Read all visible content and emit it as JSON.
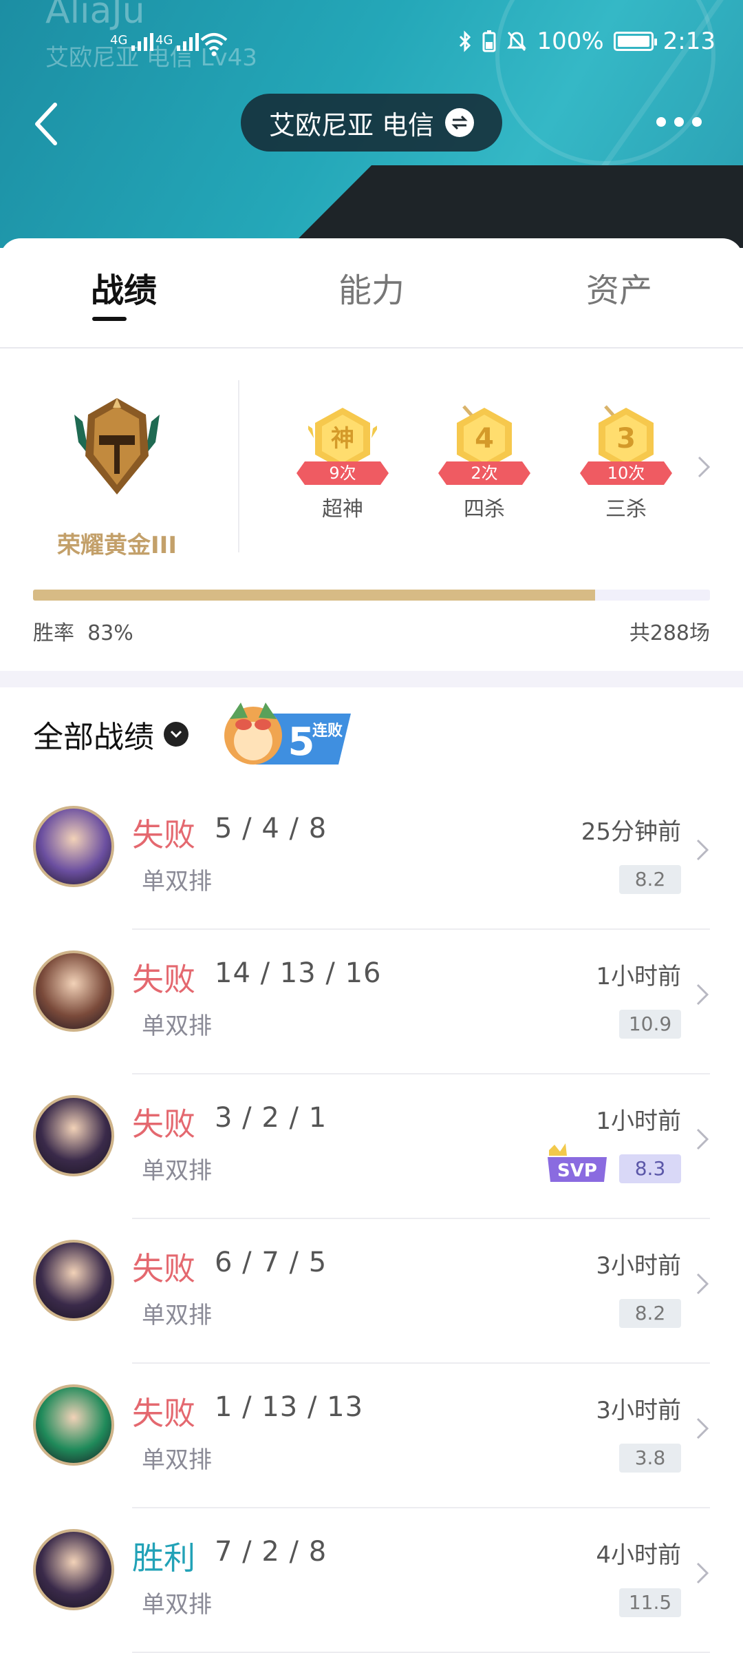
{
  "ghost_header": {
    "name": "AliaJu",
    "sub": "艾欧尼亚 电信 Lv43"
  },
  "status_bar": {
    "signal1_label": "4G",
    "signal2_label": "4G",
    "battery": "100%",
    "time": "2:13"
  },
  "nav": {
    "server": "艾欧尼亚 电信"
  },
  "tabs": [
    {
      "label": "战绩"
    },
    {
      "label": "能力"
    },
    {
      "label": "资产"
    }
  ],
  "rank": {
    "name": "荣耀黄金III"
  },
  "medals": [
    {
      "glyph": "神",
      "count": "9次",
      "label": "超神"
    },
    {
      "glyph": "4",
      "count": "2次",
      "label": "四杀"
    },
    {
      "glyph": "3",
      "count": "10次",
      "label": "三杀"
    }
  ],
  "summary": {
    "winrate_label": "胜率",
    "winrate_value": "83%",
    "winrate_fraction": 0.83,
    "total": "共288场"
  },
  "filter": {
    "label": "全部战绩",
    "streak_number": "5",
    "streak_text": "连败"
  },
  "matches": [
    {
      "result": "失败",
      "outcome": "lose",
      "kda": "5 / 4 / 8",
      "mode": "单双排",
      "time": "25分钟前",
      "score": "8.2",
      "svp": false,
      "avatar_color": "#6b4fa0"
    },
    {
      "result": "失败",
      "outcome": "lose",
      "kda": "14 / 13 / 16",
      "mode": "单双排",
      "time": "1小时前",
      "score": "10.9",
      "svp": false,
      "avatar_color": "#7a4a3a"
    },
    {
      "result": "失败",
      "outcome": "lose",
      "kda": "3 / 2 / 1",
      "mode": "单双排",
      "time": "1小时前",
      "score": "8.3",
      "svp": true,
      "svp_label": "SVP",
      "avatar_color": "#3a2a4a"
    },
    {
      "result": "失败",
      "outcome": "lose",
      "kda": "6 / 7 / 5",
      "mode": "单双排",
      "time": "3小时前",
      "score": "8.2",
      "svp": false,
      "avatar_color": "#3a2a4a"
    },
    {
      "result": "失败",
      "outcome": "lose",
      "kda": "1 / 13 / 13",
      "mode": "单双排",
      "time": "3小时前",
      "score": "3.8",
      "svp": false,
      "avatar_color": "#1f8a5a"
    },
    {
      "result": "胜利",
      "outcome": "win",
      "kda": "7 / 2 / 8",
      "mode": "单双排",
      "time": "4小时前",
      "score": "11.5",
      "svp": false,
      "avatar_color": "#3a2a4a"
    }
  ]
}
